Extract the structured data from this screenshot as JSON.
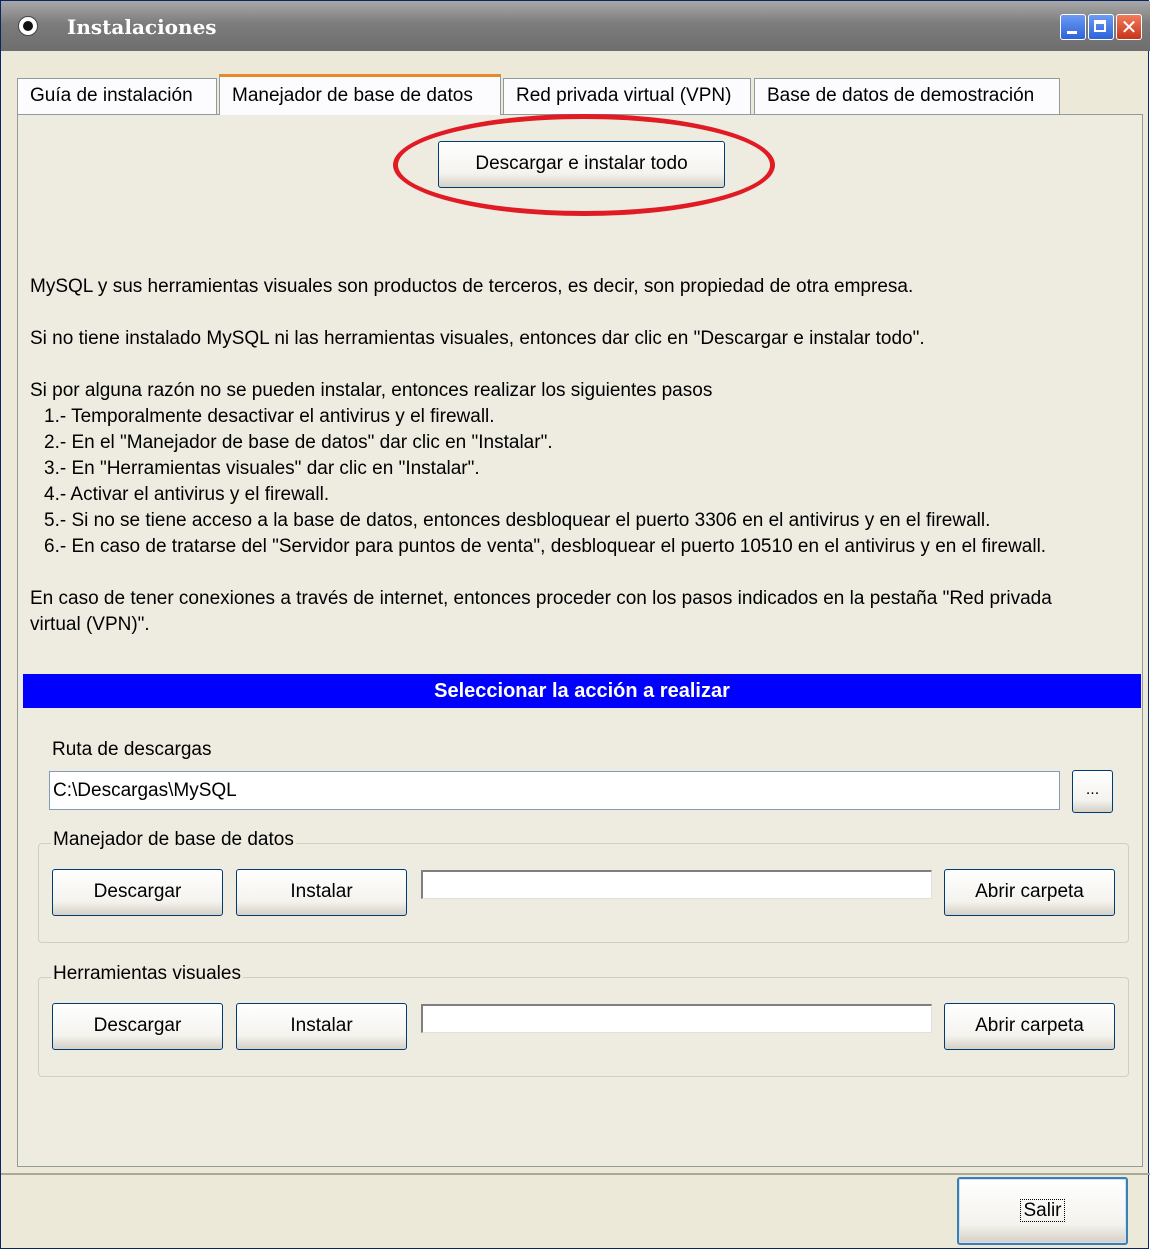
{
  "window": {
    "title": "Instalaciones"
  },
  "tabs": [
    {
      "label": "Guía de instalación",
      "active": false
    },
    {
      "label": "Manejador de base de datos",
      "active": true
    },
    {
      "label": "Red privada virtual (VPN)",
      "active": false
    },
    {
      "label": "Base de datos de demostración",
      "active": false
    }
  ],
  "main": {
    "install_all_button": "Descargar e instalar todo",
    "para1": "MySQL y sus herramientas visuales son productos de terceros, es decir, son propiedad de otra empresa.",
    "para2": "Si no tiene instalado MySQL ni las herramientas visuales, entonces dar clic en \"Descargar e instalar todo\".",
    "steps_intro": "Si por alguna razón no se pueden instalar, entonces realizar los siguientes pasos",
    "steps": [
      "1.- Temporalmente desactivar el antivirus y el firewall.",
      "2.- En el \"Manejador de base de datos\" dar clic en \"Instalar\".",
      "3.- En \"Herramientas visuales\" dar clic en \"Instalar\".",
      "4.- Activar el antivirus y el firewall.",
      "5.- Si no se tiene acceso a la base de datos, entonces desbloquear el puerto 3306 en el antivirus y en el firewall.",
      "6.- En caso de tratarse del \"Servidor para puntos de venta\", desbloquear el puerto 10510 en el antivirus y en el firewall."
    ],
    "para3_line1": "En caso de tener conexiones a través de internet, entonces proceder con los pasos indicados en la pestaña \"Red privada",
    "para3_line2": "virtual (VPN)\".",
    "section_header": "Seleccionar la acción a realizar",
    "download_path_label": "Ruta de descargas",
    "download_path_value": "C:\\Descargas\\MySQL",
    "browse_button": "...",
    "group_db": {
      "label": "Manejador de base de datos",
      "download": "Descargar",
      "install": "Instalar",
      "open_folder": "Abrir carpeta",
      "progress": 0
    },
    "group_tools": {
      "label": "Herramientas visuales",
      "download": "Descargar",
      "install": "Instalar",
      "open_folder": "Abrir carpeta",
      "progress": 0
    }
  },
  "footer": {
    "exit_button": "Salir"
  },
  "colors": {
    "section_header_bg": "#0000ff",
    "highlight_ellipse": "#e01b24",
    "active_tab_accent": "#e68b2c"
  }
}
